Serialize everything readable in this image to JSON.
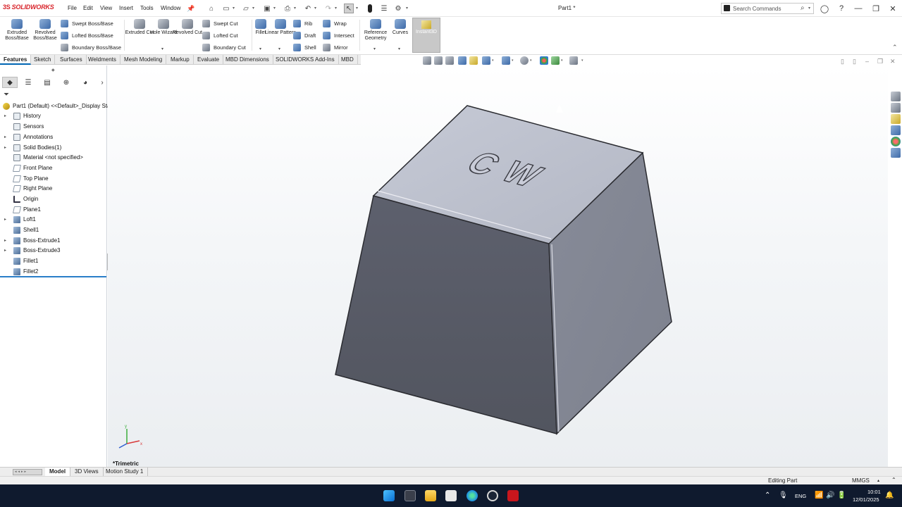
{
  "app": {
    "brand": "SOLIDWORKS",
    "brand_prefix": "3S",
    "doc_title": "Part1 *"
  },
  "menu": {
    "file": "File",
    "edit": "Edit",
    "view": "View",
    "insert": "Insert",
    "tools": "Tools",
    "window": "Window"
  },
  "search": {
    "placeholder": "Search Commands"
  },
  "ribbon": {
    "extruded_boss": "Extruded Boss/Base",
    "revolved_boss": "Revolved Boss/Base",
    "swept_boss": "Swept Boss/Base",
    "lofted_boss": "Lofted Boss/Base",
    "boundary_boss": "Boundary Boss/Base",
    "extruded_cut": "Extruded Cut",
    "hole_wizard": "Hole Wizard",
    "revolved_cut": "Revolved Cut",
    "swept_cut": "Swept Cut",
    "lofted_cut": "Lofted Cut",
    "boundary_cut": "Boundary Cut",
    "fillet": "Fillet",
    "linear_pattern": "Linear Pattern",
    "rib": "Rib",
    "draft": "Draft",
    "shell": "Shell",
    "wrap": "Wrap",
    "intersect": "Intersect",
    "mirror": "Mirror",
    "reference_geometry": "Reference Geometry",
    "curves": "Curves",
    "instant3d": "Instant3D"
  },
  "tabs": [
    "Features",
    "Sketch",
    "Surfaces",
    "Weldments",
    "Mesh Modeling",
    "Markup",
    "Evaluate",
    "MBD Dimensions",
    "SOLIDWORKS Add-Ins",
    "MBD"
  ],
  "tree": {
    "root": "Part1 (Default) <<Default>_Display Sta",
    "items": [
      "History",
      "Sensors",
      "Annotations",
      "Solid Bodies(1)",
      "Material <not specified>",
      "Front Plane",
      "Top Plane",
      "Right Plane",
      "Origin",
      "Plane1",
      "Loft1",
      "Shell1",
      "Boss-Extrude1",
      "Boss-Extrude3",
      "Fillet1",
      "Fillet2"
    ]
  },
  "model": {
    "embossed_text": "CW",
    "view_orientation": "*Trimetric"
  },
  "triad": {
    "x": "x",
    "y": "y"
  },
  "bottom_tabs": [
    "Model",
    "3D Views",
    "Motion Study 1"
  ],
  "status": {
    "mode": "Editing Part",
    "units": "MMGS"
  },
  "taskbar": {
    "language": "ENG",
    "time": "10:01",
    "date": "12/01/2025"
  },
  "colors": {
    "accent": "#0066b3",
    "brand": "#d8232a",
    "taskbar": "#0f1a2e"
  }
}
